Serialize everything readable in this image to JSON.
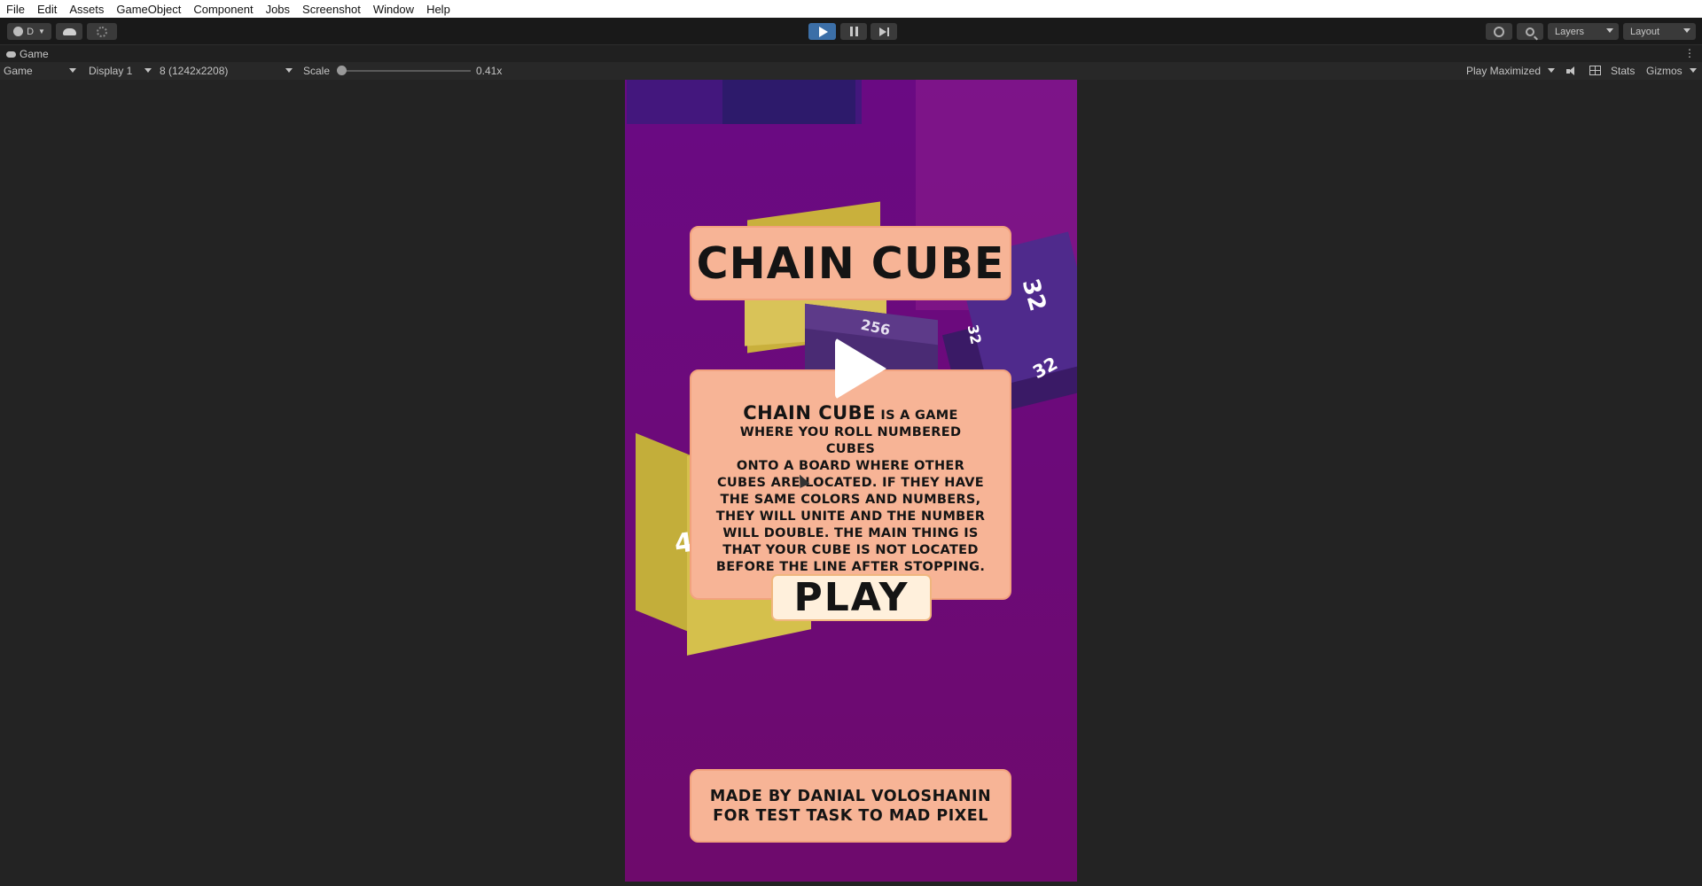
{
  "menu": [
    "File",
    "Edit",
    "Assets",
    "GameObject",
    "Component",
    "Jobs",
    "Screenshot",
    "Window",
    "Help"
  ],
  "toolbar": {
    "account_label": "D",
    "layers_label": "Layers",
    "layout_label": "Layout",
    "play_state": "playing",
    "accent_color": "#3c6fa7"
  },
  "tab": {
    "label": "Game"
  },
  "gamebar": {
    "view": "Game",
    "display": "Display 1",
    "resolution": "8 (1242x2208)",
    "scale_label": "Scale",
    "scale_value": "0.41x",
    "play_mode": "Play Maximized",
    "stats": "Stats",
    "gizmos": "Gizmos"
  },
  "game": {
    "title": "CHAIN CUBE",
    "description_brand": "CHAIN CUBE",
    "description_lines": [
      "is a game",
      "where you roll numbered cubes",
      "onto a board where other",
      "cubes are located. If they have",
      "the same colors and numbers,",
      "they will unite and the number",
      "will double. The main thing is",
      "that your cube is not located",
      "before the line after stopping."
    ],
    "play_button": "PLAY",
    "credit_line1": "made by Danial Voloshanin",
    "credit_line2": "for test task to Mad Pixel",
    "cube_labels": {
      "mid": "256",
      "right_top": "32",
      "right_bottom": "32",
      "right_side": "32",
      "left": "4"
    },
    "background_color": "#6a0a83",
    "panel_color": "#f7b496"
  }
}
